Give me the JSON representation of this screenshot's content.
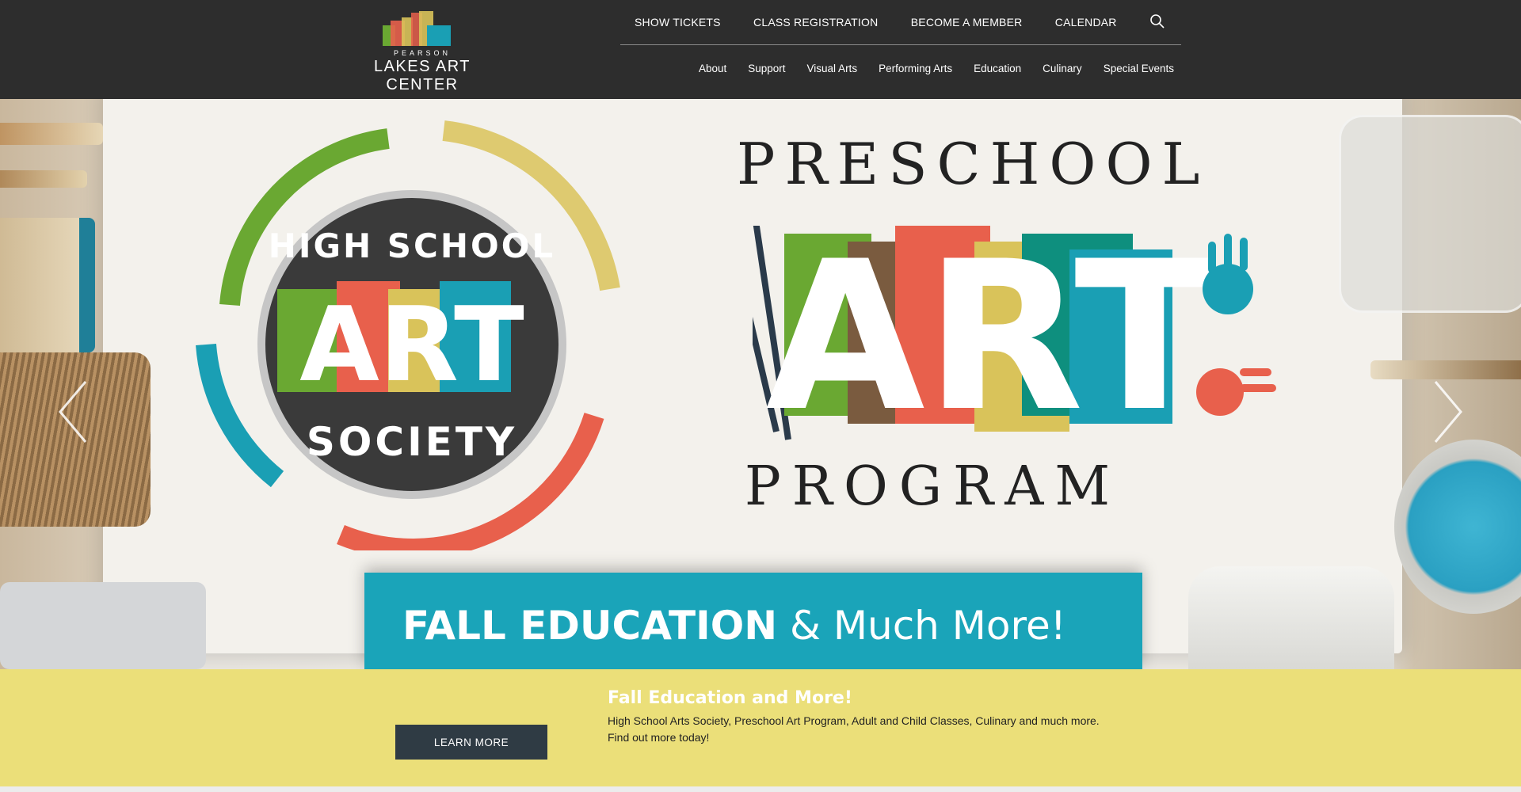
{
  "header": {
    "logo": {
      "small_text": "PEARSON",
      "name": "LAKES ART CENTER"
    },
    "topnav": [
      {
        "label": "SHOW TICKETS"
      },
      {
        "label": "CLASS REGISTRATION"
      },
      {
        "label": "BECOME A MEMBER"
      },
      {
        "label": "CALENDAR"
      }
    ],
    "search_icon": "search-icon",
    "subnav": [
      {
        "label": "About"
      },
      {
        "label": "Support"
      },
      {
        "label": "Visual Arts"
      },
      {
        "label": "Performing Arts"
      },
      {
        "label": "Education"
      },
      {
        "label": "Culinary"
      },
      {
        "label": "Special Events"
      }
    ]
  },
  "hero": {
    "high_school_badge": {
      "top": "HIGH SCHOOL",
      "middle": "ART",
      "bottom": "SOCIETY"
    },
    "preschool": {
      "top": "PRESCHOOL",
      "middle": "ART",
      "bottom": "PROGRAM"
    },
    "banner": {
      "bold": "FALL EDUCATION",
      "rest": "& Much More!"
    },
    "prev_icon": "chevron-left-icon",
    "next_icon": "chevron-right-icon"
  },
  "caption": {
    "title": "Fall Education and More!",
    "body": "High School Arts Society, Preschool Art Program, Adult and Child Classes, Culinary and much more. Find out more today!",
    "button_label": "LEARN MORE"
  },
  "colors": {
    "header_bg": "#2d2d2d",
    "caption_bg": "#ebdf79",
    "banner_bg": "#1aa4b9",
    "button_bg": "#2f3b44",
    "green": "#6aa832",
    "brown": "#7a5b3f",
    "red": "#e8604c",
    "yellow": "#d9c35a",
    "teal": "#1a9fb4"
  }
}
